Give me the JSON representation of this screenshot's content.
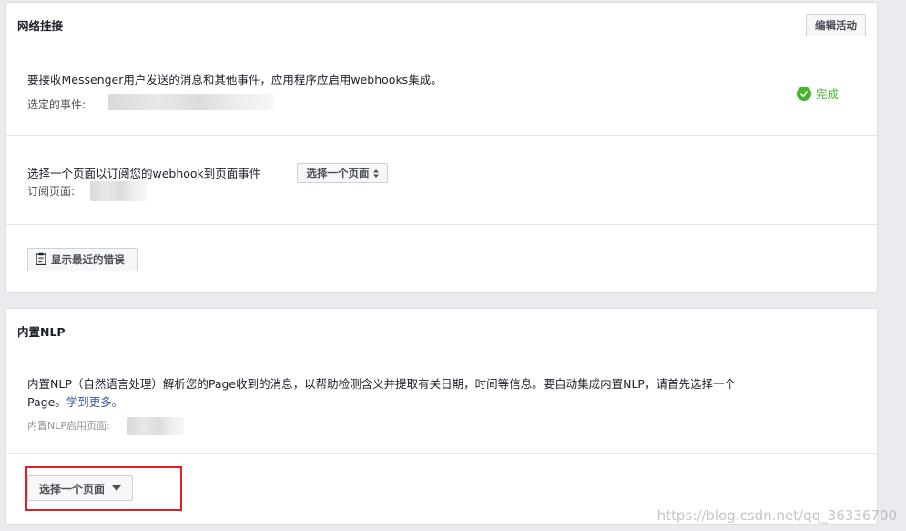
{
  "webhooks": {
    "title": "网络挂接",
    "edit_label": "编辑活动",
    "description": "要接收Messenger用户发送的消息和其他事件，应用程序应启用webhooks集成。",
    "events_label": "选定的事件:",
    "status_label": "完成",
    "subscribe_text": "选择一个页面以订阅您的webhook到页面事件",
    "subscribe_page_label": "订阅页面:",
    "select_page_label": "选择一个页面",
    "show_errors_label": "显示最近的错误"
  },
  "nlp": {
    "title": "内置NLP",
    "description_line1": "内置NLP（自然语言处理）解析您的Page收到的消息，以帮助检测含义并提取有关日期，时间等信息。要自动集成内置NLP，请首先选择一个",
    "description_line2": "Page。",
    "learn_more": "学到更多。",
    "enabled_pages_label": "内置NLP启用页面:",
    "select_page_label": "选择一个页面"
  },
  "watermark": "https://blog.csdn.net/qq_36336700",
  "colors": {
    "success": "#42b72a",
    "link": "#365899",
    "highlight": "#e02020"
  }
}
